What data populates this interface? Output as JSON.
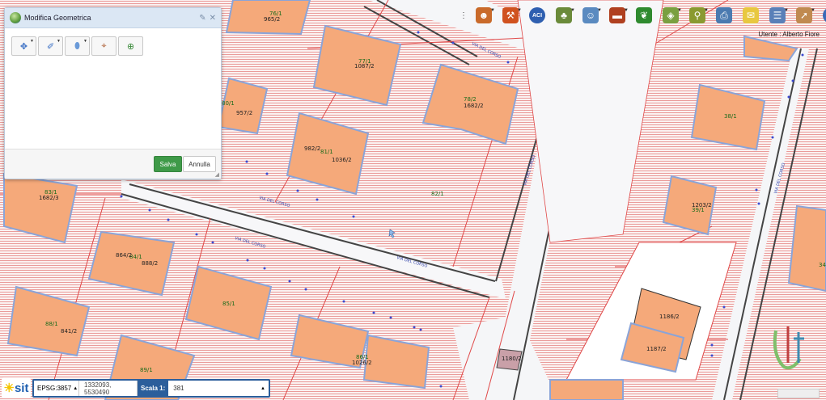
{
  "panel": {
    "title": "Modifica Geometrica",
    "save_label": "Salva",
    "cancel_label": "Annulla",
    "tools": [
      "move-icon",
      "edit-vertex-icon",
      "draw-shape-icon",
      "select-icon",
      "zoom-globe-icon"
    ]
  },
  "toolbar": {
    "icons": [
      "user-edit-icon",
      "tools-icon",
      "aci-icon",
      "plant-icon",
      "user-group-icon",
      "tray-icon",
      "leaf-icon",
      "map-layers-icon",
      "search-icon",
      "print-icon",
      "note-icon",
      "report-icon",
      "pointer-icon",
      "help-icon"
    ],
    "aci_label": "ACI",
    "help_label": "?"
  },
  "user": {
    "label": "Utente : Alberto Fiore"
  },
  "bottom": {
    "logo_text": "sit",
    "epsg": "EPSG:3857",
    "coordinates": "1332093, 5530490",
    "scale_label": "Scala 1:",
    "scale_value": "381"
  },
  "map_labels": {
    "p76_1": "76/1",
    "p76_1n": "965/2",
    "p77_1": "77/1",
    "p77_1n": "1087/2",
    "p78_2": "78/2",
    "p78_2n": "1682/2",
    "p80_1": "80/1",
    "p80_1n": "957/2",
    "p81_1": "81/1",
    "p81_1a": "982/2",
    "p81_1b": "1036/2",
    "p82_1": "82/1",
    "p83_1": "83/1",
    "p83_1n": "1682/3",
    "p84_1": "84/1",
    "p84_1a": "864/2",
    "p84_1b": "888/2",
    "p85_1": "85/1",
    "p86_1": "86/1",
    "p86_1n": "1026/2",
    "p88_1": "88/1",
    "p88_1n": "841/2",
    "p89_1": "89/1",
    "p38_1": "38/1",
    "p39_1": "39/1",
    "p39_1n": "1203/2",
    "p1186": "1186/2",
    "p1187": "1187/2",
    "p1180": "1180/2",
    "p34": "34",
    "street": "VIA DEL CORSO"
  }
}
